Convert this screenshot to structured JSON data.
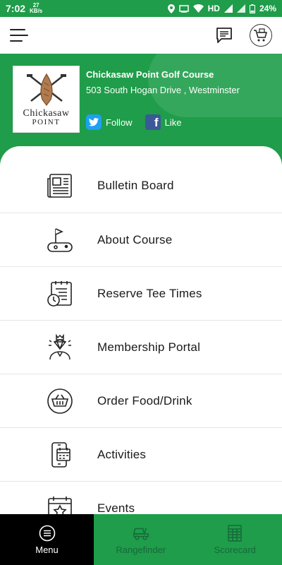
{
  "status_bar": {
    "time": "7:02",
    "kb_value": "27",
    "kb_unit": "KB/s",
    "network": "HD",
    "battery": "24%"
  },
  "header": {
    "menu_icon": "hamburger-icon",
    "chat_icon": "chat-icon",
    "shop_icon": "shopping-cart-icon"
  },
  "club": {
    "name": "Chickasaw Point Golf Course",
    "address": "503 South Hogan Drive , Westminster",
    "logo_line1": "Chickasaw",
    "logo_line2": "POINT",
    "twitter_label": "Follow",
    "facebook_label": "Like",
    "brand_color": "#1f9d4a"
  },
  "menu": {
    "items": [
      {
        "label": "Bulletin Board",
        "icon": "newspaper-icon"
      },
      {
        "label": "About Course",
        "icon": "golf-flag-icon"
      },
      {
        "label": "Reserve Tee Times",
        "icon": "calendar-clock-icon"
      },
      {
        "label": "Membership Portal",
        "icon": "membership-badge-icon"
      },
      {
        "label": "Order Food/Drink",
        "icon": "food-basket-icon"
      },
      {
        "label": "Activities",
        "icon": "phone-calendar-icon"
      },
      {
        "label": "Events",
        "icon": "event-calendar-icon"
      }
    ]
  },
  "bottom_nav": {
    "items": [
      {
        "label": "Menu",
        "icon": "menu-circle-icon"
      },
      {
        "label": "Rangefinder",
        "icon": "golf-cart-icon"
      },
      {
        "label": "Scorecard",
        "icon": "scorecard-icon"
      }
    ]
  }
}
